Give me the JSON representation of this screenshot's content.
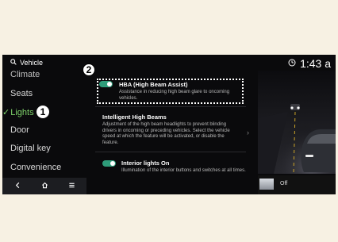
{
  "header": {
    "search_label": "Vehicle",
    "time": "1:43 a"
  },
  "sidebar": {
    "items": [
      {
        "label": "Climate"
      },
      {
        "label": "Seats"
      },
      {
        "label": "Lights",
        "active": true
      },
      {
        "label": "Door"
      },
      {
        "label": "Digital key"
      },
      {
        "label": "Convenience"
      }
    ]
  },
  "content": {
    "options": [
      {
        "title": "HBA (High Beam Assist)",
        "description": "Assistance in reducing high beam glare to oncoming vehicles.",
        "toggle_on": true
      },
      {
        "title": "Intelligent High Beams",
        "description": "Adjustment of the high beam headlights to prevent blinding drivers in oncoming or preceding vehicles. Select the vehicle speed at which the feature will be activated, or disable the feature.",
        "has_chevron": true
      },
      {
        "title": "Interior lights On",
        "description": "Illumination of the interior buttons and switches at all times.",
        "toggle_on": true
      }
    ]
  },
  "mini_player": {
    "label": "Off"
  },
  "callouts": {
    "one": "1",
    "two": "2"
  },
  "colors": {
    "accent_green": "#7fd36b",
    "toggle": "#2e9c7a",
    "background": "#0a0a0c",
    "page_bg": "#f7f1e3"
  },
  "icons": [
    "search-icon",
    "clock-icon",
    "check-icon",
    "back-icon",
    "home-icon",
    "menu-icon",
    "chevron-right-icon"
  ]
}
